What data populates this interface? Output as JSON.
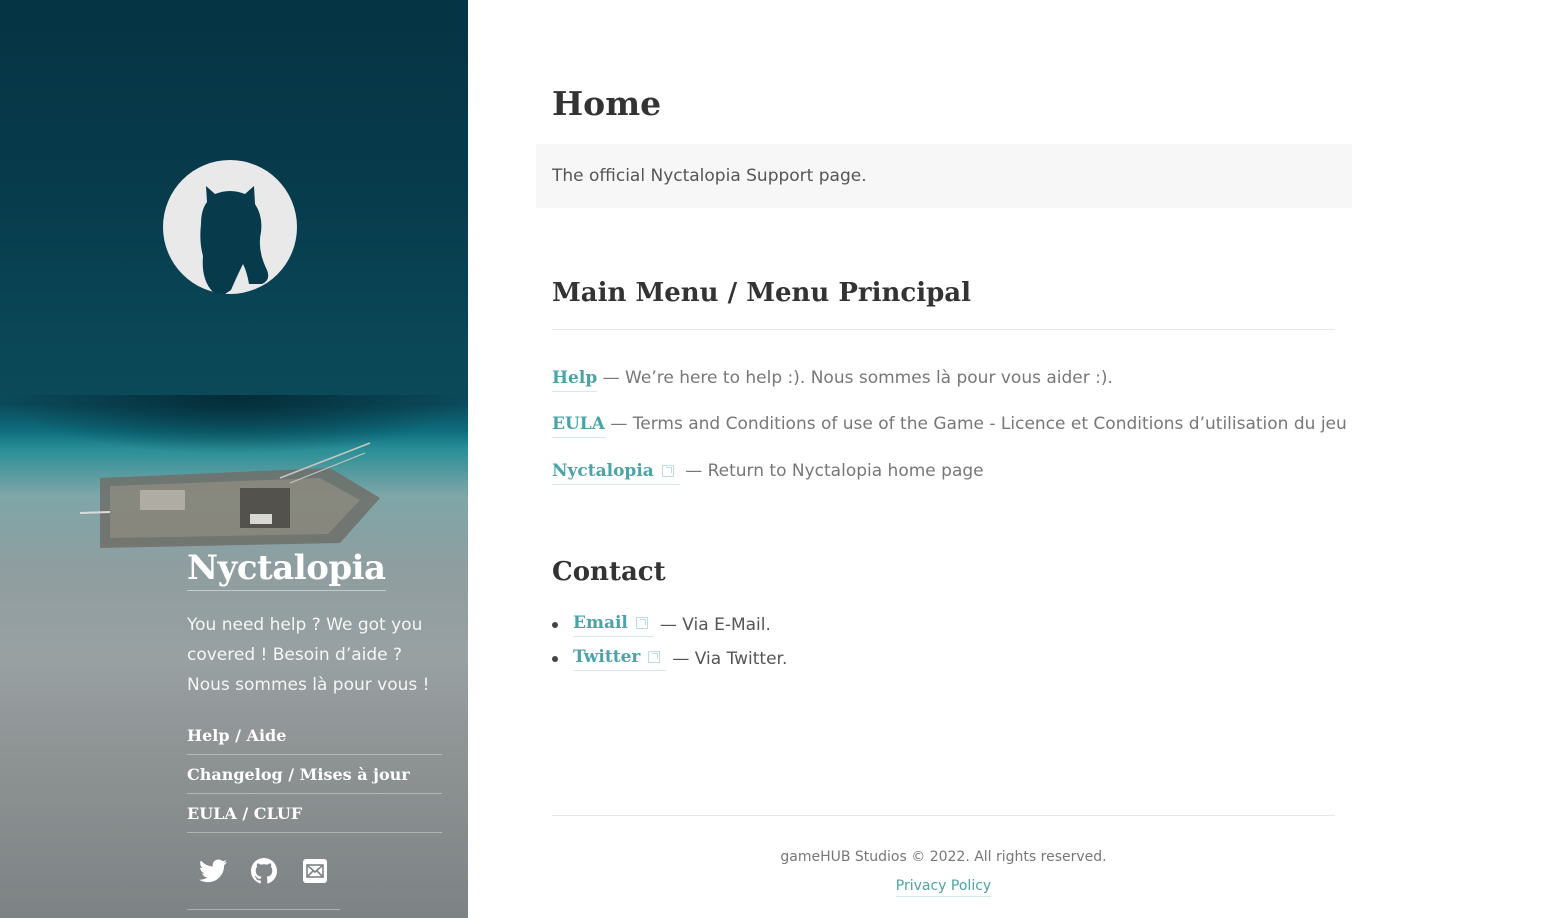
{
  "sidebar": {
    "site_title": "Nyctalopia",
    "tagline": "You need help ? We got you covered ! Besoin d’aide ? Nous sommes là pour vous !",
    "nav": [
      {
        "label": "Help / Aide"
      },
      {
        "label": "Changelog / Mises à jour"
      },
      {
        "label": "EULA / CLUF"
      }
    ],
    "social": [
      {
        "icon": "twitter-icon"
      },
      {
        "icon": "github-icon"
      },
      {
        "icon": "email-icon"
      }
    ]
  },
  "main": {
    "page_title": "Home",
    "intro": "The official Nyctalopia Support page.",
    "menu_heading": "Main Menu / Menu Principal",
    "menu": [
      {
        "link": "Help",
        "desc": "— We’re here to help :). Nous sommes là pour vous aider :).",
        "external": false
      },
      {
        "link": "EULA",
        "desc": "— Terms and Conditions of use of the Game - Licence et Conditions d’utilisation du jeu",
        "external": false
      },
      {
        "link": "Nyctalopia",
        "desc": "— Return to Nyctalopia home page",
        "external": true
      }
    ],
    "contact_heading": "Contact",
    "contact": [
      {
        "link": "Email",
        "desc": "— Via E-Mail."
      },
      {
        "link": "Twitter",
        "desc": "— Via Twitter."
      }
    ]
  },
  "footer": {
    "copyright": "gameHUB Studios © 2022. All rights reserved.",
    "privacy": "Privacy Policy"
  },
  "colors": {
    "accent": "#4aa3a8",
    "heading": "#333333",
    "sidebar_top": "#053444"
  }
}
